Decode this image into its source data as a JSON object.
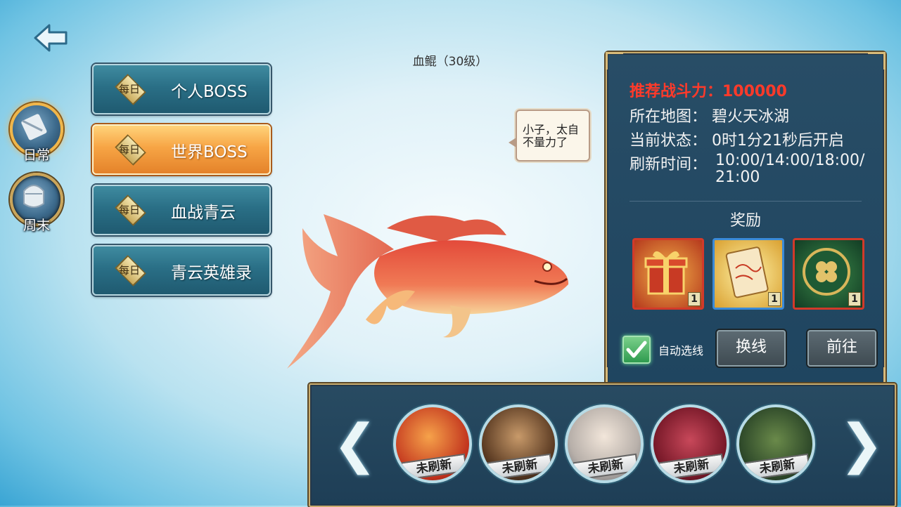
{
  "nav": {
    "back_icon": "back-arrow-icon"
  },
  "side_tabs": [
    {
      "label": "日常",
      "icon": "daily-scroll-icon",
      "active": true
    },
    {
      "label": "周末",
      "icon": "weekend-helmet-icon",
      "active": false
    }
  ],
  "menu": [
    {
      "badge": "每日",
      "title": "个人BOSS",
      "active": false
    },
    {
      "badge": "每日",
      "title": "世界BOSS",
      "active": true
    },
    {
      "badge": "每日",
      "title": "血战青云",
      "active": false
    },
    {
      "badge": "每日",
      "title": "青云英雄录",
      "active": false
    }
  ],
  "boss": {
    "name": "血鲲（30级）",
    "speech_line1": "小子，太自",
    "speech_line2": "不量力了"
  },
  "info": {
    "recommend": "推荐战斗力：100000",
    "map": "所在地图：  碧火天冰湖",
    "status": "当前状态：  0时1分21秒后开启",
    "refresh_label": "刷新时间：",
    "refresh_line1": "10:00/14:00/18:00/",
    "refresh_line2": "21:00",
    "reward_title": "奖励",
    "rewards": [
      {
        "name": "gift-box-icon",
        "qty": "1",
        "frame": "#d23a2a"
      },
      {
        "name": "scroll-icon",
        "qty": "1",
        "frame": "#3a8ad8"
      },
      {
        "name": "clover-medal-icon",
        "qty": "1",
        "frame": "#d23a2a"
      }
    ],
    "auto_label": "自动选线",
    "auto_checked": true,
    "switch_button": "换线",
    "go_button": "前往"
  },
  "boss_list": [
    {
      "name": "red-fish-boss-portrait",
      "tag": "未刷新"
    },
    {
      "name": "bearded-warrior-portrait",
      "tag": "未刷新"
    },
    {
      "name": "white-haired-elder-portrait",
      "tag": "未刷新"
    },
    {
      "name": "crimson-demon-portrait",
      "tag": "未刷新"
    },
    {
      "name": "green-beast-portrait",
      "tag": "未刷新"
    }
  ],
  "colors": {
    "accent_red": "#ff3a2a",
    "panel": "#244a63",
    "gold_frame": "#c9ac6d"
  }
}
